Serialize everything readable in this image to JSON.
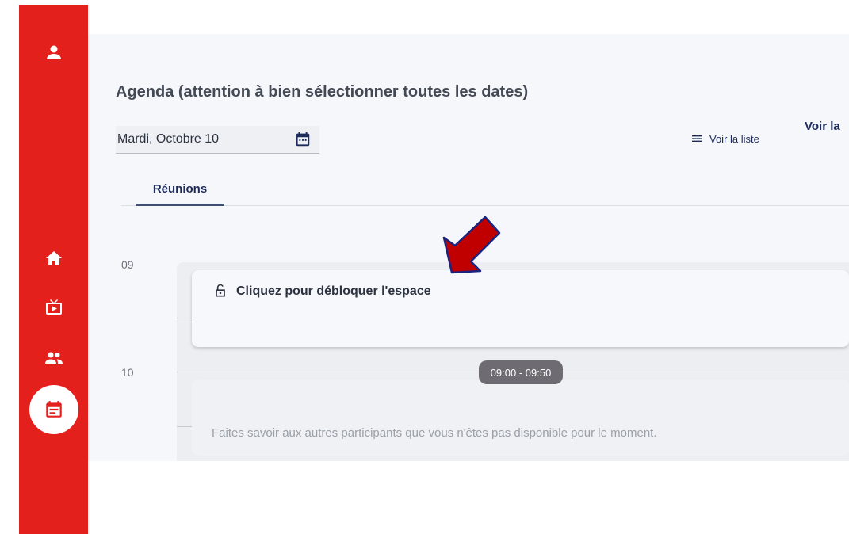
{
  "sidebar": {
    "items": [
      {
        "icon": "user-icon"
      },
      {
        "icon": "home-icon"
      },
      {
        "icon": "tv-icon"
      },
      {
        "icon": "people-icon"
      },
      {
        "icon": "calendar-icon",
        "active": true
      }
    ],
    "color": "#e3201b"
  },
  "agenda": {
    "title": "Agenda (attention à bien sélectionner toutes les dates)",
    "date_value": "Mardi, Octobre 10",
    "view_list_label": "Voir la liste",
    "view_partial_label": "Voir la"
  },
  "tabs": [
    {
      "label": "Réunions",
      "active": true
    }
  ],
  "timeline": {
    "hours": [
      "09",
      "10"
    ],
    "event": {
      "title": "Cliquez pour débloquer l'espace",
      "icon": "lock-open-icon"
    },
    "time_range": "09:00 - 09:50",
    "busy_message": "Faites savoir aux autres participants que vous n'êtes pas disponible pour le moment."
  },
  "annotation": {
    "arrow_color": "#c00000",
    "arrow_outline": "#1a237e"
  }
}
